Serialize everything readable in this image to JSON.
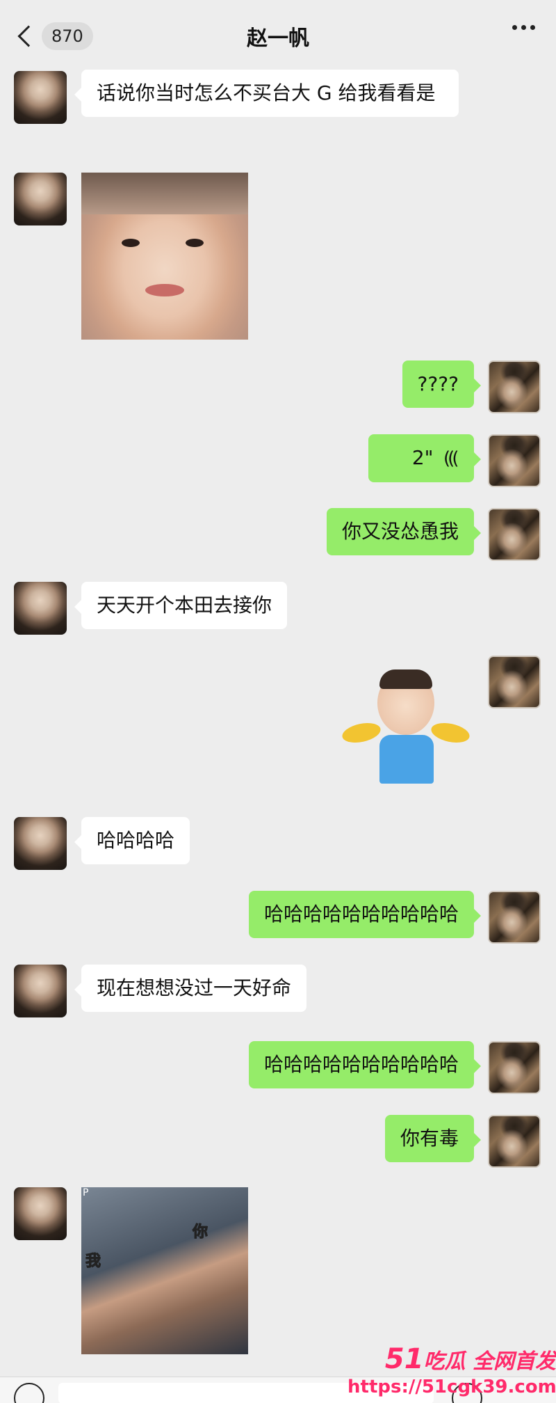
{
  "header": {
    "unread_count": "870",
    "title": "赵一帆"
  },
  "messages": [
    {
      "side": "left",
      "type": "text",
      "text": "话说你当时怎么不买台大 G 给我看看是"
    },
    {
      "side": "left",
      "type": "sticker",
      "name": "baby-face"
    },
    {
      "side": "right",
      "type": "text",
      "text": "????"
    },
    {
      "side": "right",
      "type": "voice",
      "duration": "2\""
    },
    {
      "side": "right",
      "type": "text",
      "text": "你又没怂恿我"
    },
    {
      "side": "left",
      "type": "text",
      "text": "天天开个本田去接你"
    },
    {
      "side": "right",
      "type": "sticker",
      "name": "shrug-baby"
    },
    {
      "side": "left",
      "type": "text",
      "text": "哈哈哈哈"
    },
    {
      "side": "right",
      "type": "text",
      "text": "哈哈哈哈哈哈哈哈哈哈"
    },
    {
      "side": "left",
      "type": "text",
      "text": "现在想想没过一天好命"
    },
    {
      "side": "right",
      "type": "text",
      "text": "哈哈哈哈哈哈哈哈哈哈"
    },
    {
      "side": "right",
      "type": "text",
      "text": "你有毒"
    },
    {
      "side": "left",
      "type": "sticker",
      "name": "arm-wrestle-gif",
      "labels": [
        "你",
        "我"
      ],
      "tag": "P"
    }
  ],
  "watermark": {
    "num": "51",
    "text": "吃瓜 全网首发",
    "url": "https://51cgk39.com"
  }
}
